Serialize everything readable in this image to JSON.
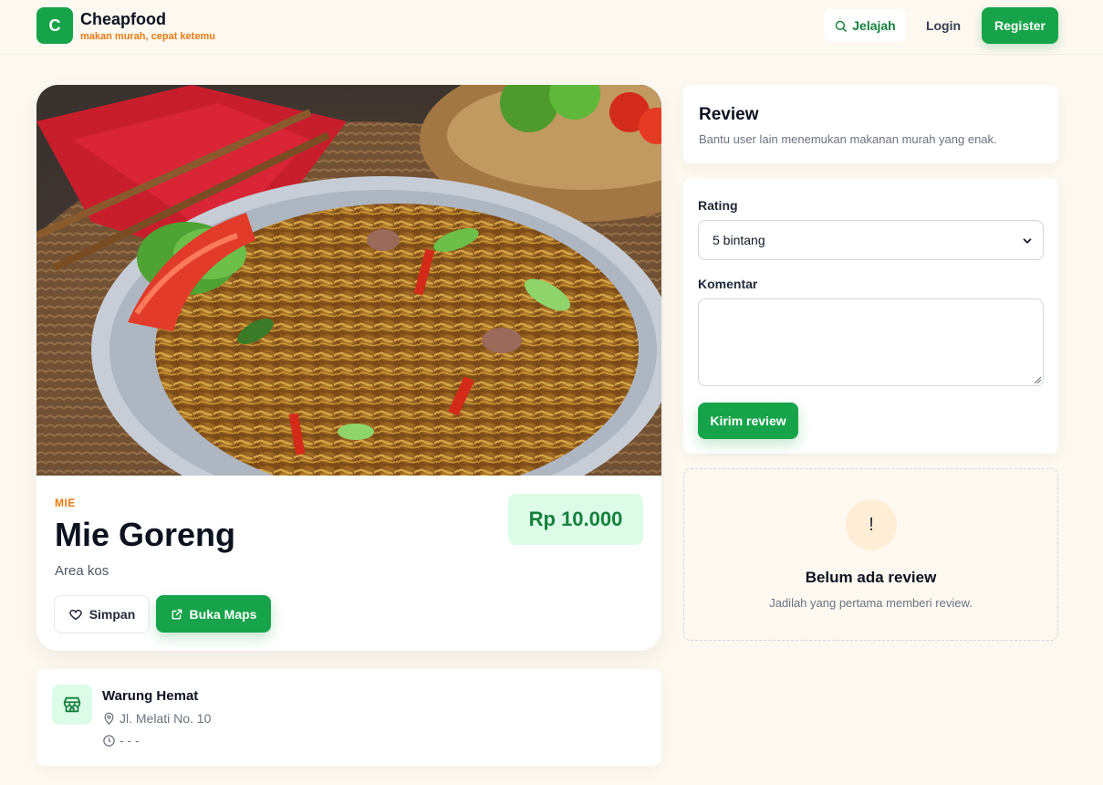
{
  "brand": {
    "logo_letter": "C",
    "name": "Cheapfood",
    "tagline": "makan murah, cepat ketemu"
  },
  "nav": {
    "explore_label": "Jelajah",
    "login_label": "Login",
    "register_label": "Register"
  },
  "food": {
    "category": "MIE",
    "name": "Mie Goreng",
    "area": "Area kos",
    "price": "Rp 10.000",
    "save_label": "Simpan",
    "maps_label": "Buka Maps"
  },
  "store": {
    "name": "Warung Hemat",
    "address": "Jl. Melati No. 10",
    "hours": "- - -"
  },
  "review": {
    "title": "Review",
    "subtitle": "Bantu user lain menemukan makanan murah yang enak.",
    "rating_label": "Rating",
    "rating_value": "5 bintang",
    "comment_label": "Komentar",
    "comment_value": "",
    "send_label": "Kirim review",
    "empty_icon": "!",
    "empty_title": "Belum ada review",
    "empty_subtitle": "Jadilah yang pertama memberi review."
  },
  "colors": {
    "brand_green": "#16a34a",
    "accent_orange": "#ea7a13",
    "background": "#fdf8f0"
  }
}
